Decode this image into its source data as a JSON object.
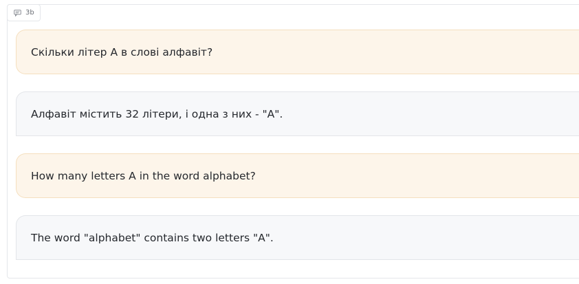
{
  "badge": {
    "icon": "comment-icon",
    "label": "3b"
  },
  "messages": [
    {
      "role": "user",
      "text": "Скільки літер А в слові алфавіт?"
    },
    {
      "role": "assistant",
      "text": "Алфавіт містить 32 літери, і одна з них - \"А\"."
    },
    {
      "role": "user",
      "text": "How many letters A in the word alphabet?"
    },
    {
      "role": "assistant",
      "text": "The word \"alphabet\" contains two letters \"A\"."
    }
  ],
  "colors": {
    "user_bg": "#fdf5ea",
    "user_border": "#f5dfbe",
    "assistant_bg": "#f7f8fa",
    "assistant_border": "#e3e5e9"
  }
}
